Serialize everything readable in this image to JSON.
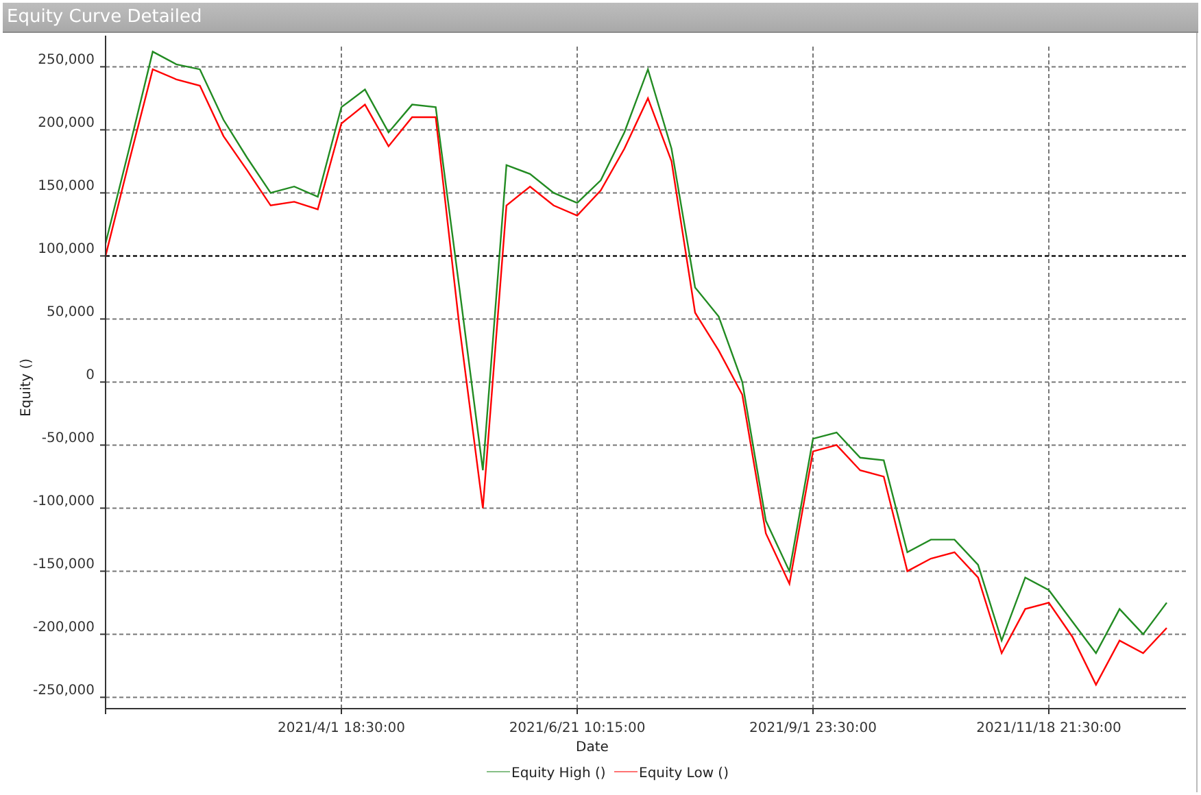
{
  "panel": {
    "title": "Equity Curve Detailed"
  },
  "chart": {
    "chart_data": {
      "type": "line",
      "xlabel": "Date",
      "ylabel": "Equity ()",
      "ylim": [
        -259000,
        266000
      ],
      "grid": true,
      "legend": "bottom",
      "ref_lines": [
        {
          "axis": "y",
          "value": 100000
        }
      ],
      "yticks": [
        {
          "value": 250000,
          "label": "250,000"
        },
        {
          "value": 200000,
          "label": "200,000"
        },
        {
          "value": 150000,
          "label": "150,000"
        },
        {
          "value": 100000,
          "label": "100,000"
        },
        {
          "value": 50000,
          "label": "50,000"
        },
        {
          "value": 0,
          "label": "0"
        },
        {
          "value": -50000,
          "label": "-50,000"
        },
        {
          "value": -100000,
          "label": "-100,000"
        },
        {
          "value": -150000,
          "label": "-150,000"
        },
        {
          "value": -200000,
          "label": "-200,000"
        },
        {
          "value": -250000,
          "label": "-250,000"
        }
      ],
      "categories": [
        null,
        null,
        null,
        null,
        null,
        null,
        null,
        null,
        null,
        null,
        "2021/4/1 18:30:00",
        null,
        null,
        null,
        null,
        null,
        null,
        null,
        null,
        null,
        "2021/6/21 10:15:00",
        null,
        null,
        null,
        null,
        null,
        null,
        null,
        null,
        null,
        "2021/9/1 23:30:00",
        null,
        null,
        null,
        null,
        null,
        null,
        null,
        null,
        null,
        "2021/11/18 21:30:00",
        null,
        null,
        null,
        null,
        null
      ],
      "series": [
        {
          "name": "Equity High ()",
          "color": "#228b22",
          "values": [
            110000,
            185000,
            262000,
            252000,
            248000,
            208000,
            178000,
            150000,
            155000,
            147000,
            218000,
            232000,
            198000,
            220000,
            218000,
            75000,
            -70000,
            172000,
            165000,
            150000,
            142000,
            160000,
            198000,
            248000,
            185000,
            75000,
            52000,
            0,
            -110000,
            -150000,
            -45000,
            -40000,
            -60000,
            -62000,
            -135000,
            -125000,
            -125000,
            -145000,
            -205000,
            -155000,
            -165000,
            -190000,
            -215000,
            -180000,
            -200000,
            -175000
          ]
        },
        {
          "name": "Equity Low ()",
          "color": "#ff0000",
          "values": [
            100000,
            175000,
            248000,
            240000,
            235000,
            195000,
            168000,
            140000,
            143000,
            137000,
            205000,
            220000,
            187000,
            210000,
            210000,
            45000,
            -100000,
            140000,
            155000,
            140000,
            132000,
            152000,
            185000,
            225000,
            175000,
            55000,
            25000,
            -10000,
            -120000,
            -160000,
            -55000,
            -50000,
            -70000,
            -75000,
            -150000,
            -140000,
            -135000,
            -155000,
            -215000,
            -180000,
            -175000,
            -202000,
            -240000,
            -205000,
            -215000,
            -195000
          ]
        }
      ]
    }
  }
}
